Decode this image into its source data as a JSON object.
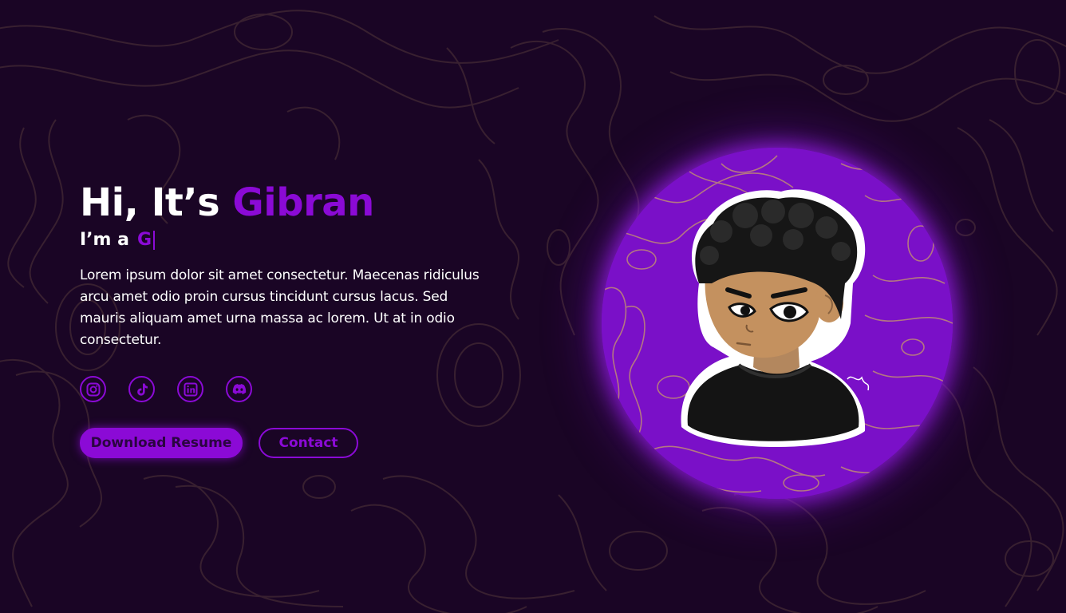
{
  "hero": {
    "greeting": "Hi, It’s ",
    "name": "Gibran",
    "role_prefix": "I’m a",
    "role_typed": "G",
    "description": "Lorem ipsum dolor sit amet consectetur. Maecenas ridiculus arcu amet odio proin cursus tincidunt cursus lacus. Sed mauris aliquam amet urna massa ac lorem. Ut at in odio consectetur."
  },
  "socials": [
    {
      "icon": "instagram-icon"
    },
    {
      "icon": "tiktok-icon"
    },
    {
      "icon": "linkedin-icon"
    },
    {
      "icon": "discord-icon"
    }
  ],
  "buttons": {
    "download_label": "Download Resume",
    "contact_label": "Contact"
  },
  "colors": {
    "background": "#1a0525",
    "accent": "#8b0ad6",
    "text": "#ffffff",
    "avatar_bg": "#7a10c8"
  }
}
